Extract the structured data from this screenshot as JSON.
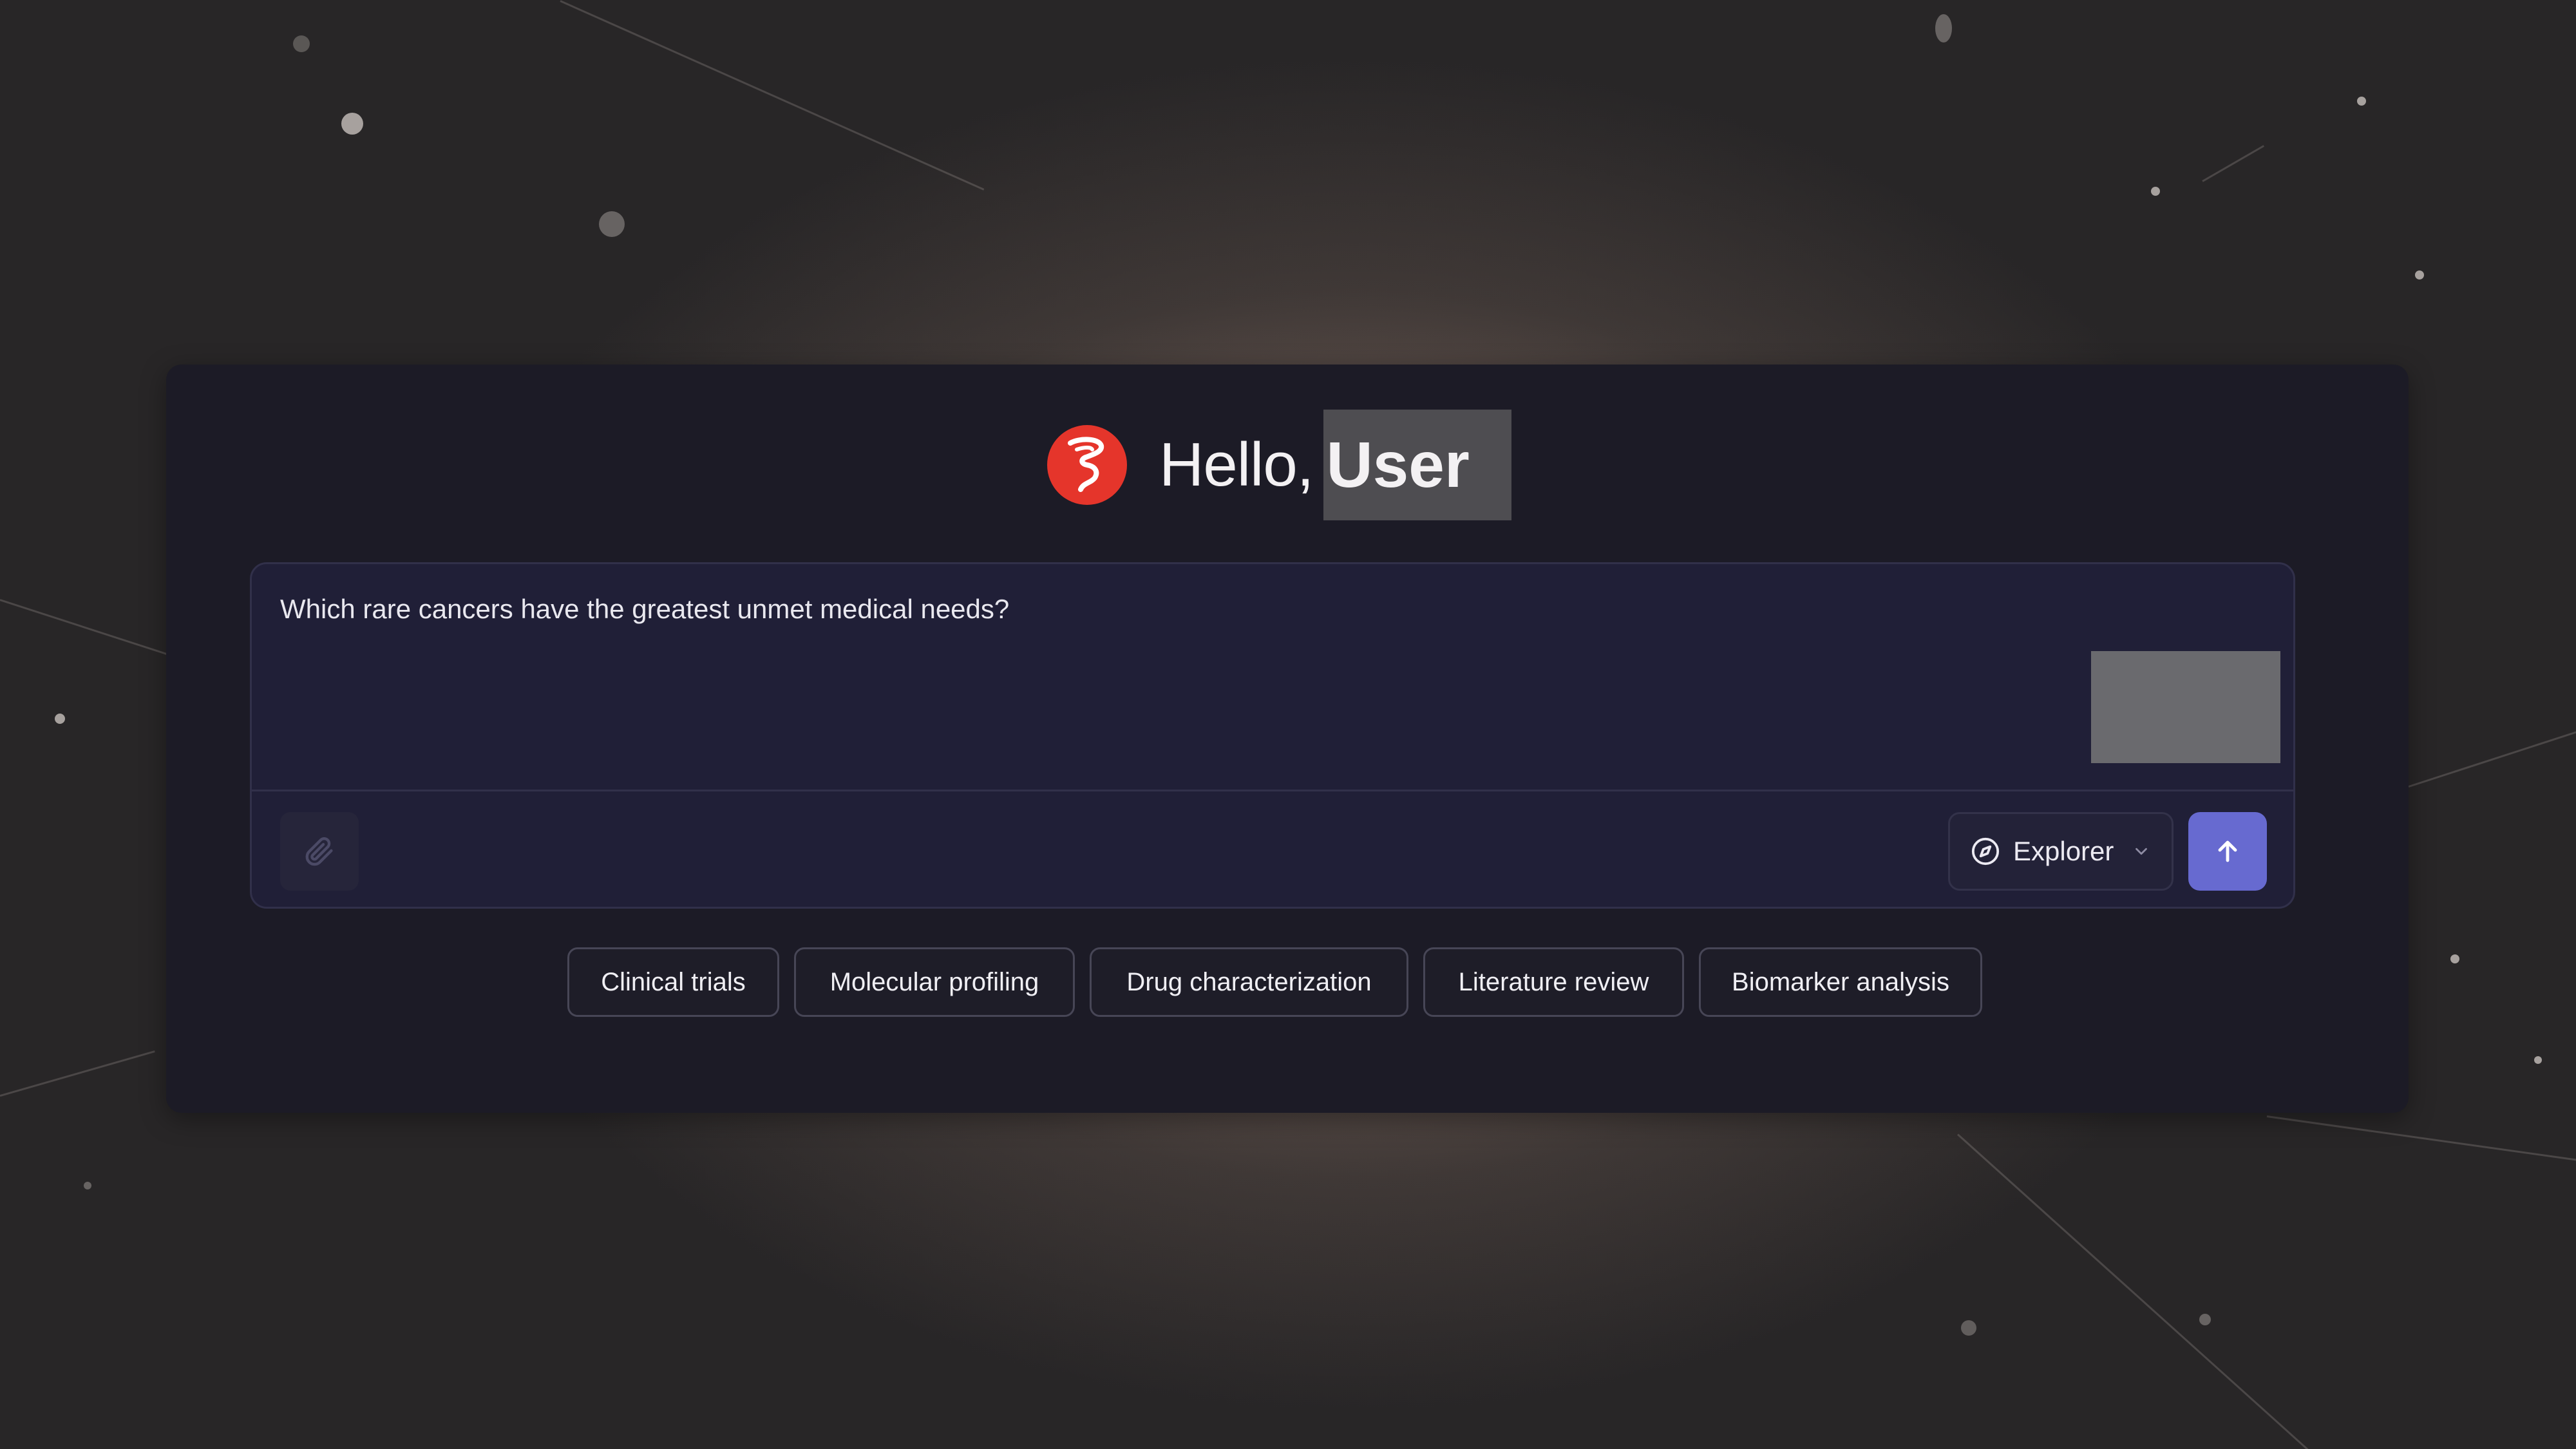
{
  "greeting": {
    "hello_text": "Hello,",
    "user_name": "User"
  },
  "query": {
    "text": "Which rare cancers have the greatest unmet medical needs?"
  },
  "toolbar": {
    "attach_icon": "paperclip-icon",
    "mode_icon": "compass-icon",
    "mode_label": "Explorer",
    "mode_dropdown_icon": "chevron-down-icon",
    "send_icon": "arrow-up-icon"
  },
  "suggestions": [
    "Clinical trials",
    "Molecular profiling",
    "Drug characterization",
    "Literature review",
    "Biomarker analysis"
  ],
  "colors": {
    "brand": "#e5352b",
    "accent": "#676ad0",
    "panel": "#1c1b26",
    "input_background": "#201f37"
  }
}
